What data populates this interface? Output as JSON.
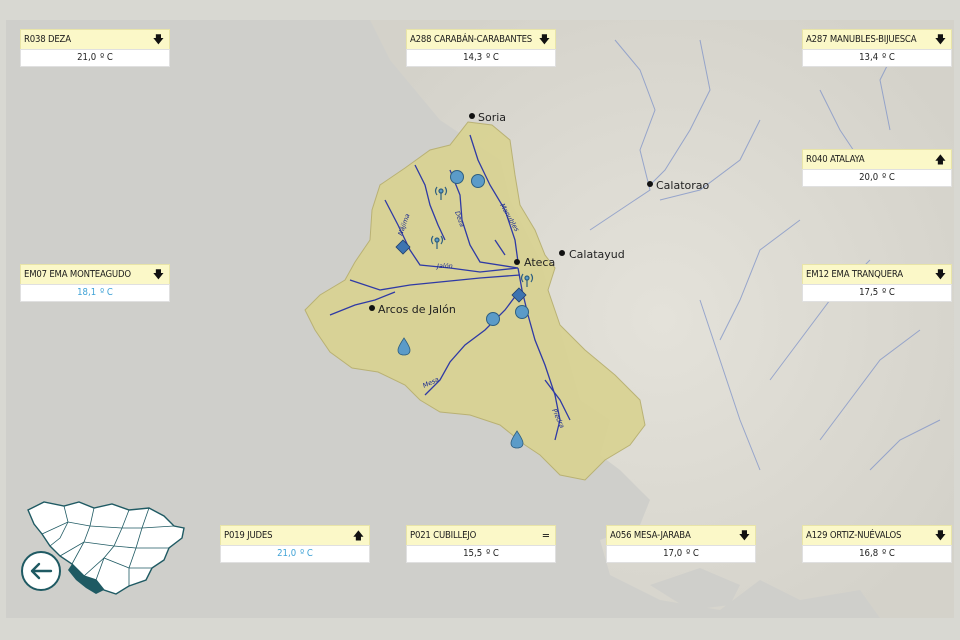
{
  "map": {
    "cities": [
      {
        "id": "soria",
        "label": "Soria"
      },
      {
        "id": "calatorao",
        "label": "Calatorao"
      },
      {
        "id": "calatayud",
        "label": "Calatayud"
      },
      {
        "id": "ateca",
        "label": "Ateca"
      },
      {
        "id": "arcos",
        "label": "Arcos de Jalón"
      }
    ],
    "rivers": [
      {
        "id": "jalon",
        "label": "Jalón"
      },
      {
        "id": "manubles",
        "label": "Manubles"
      },
      {
        "id": "deza",
        "label": "Deza"
      },
      {
        "id": "mesa",
        "label": "Mesa"
      },
      {
        "id": "piedra",
        "label": "Piedra"
      },
      {
        "id": "najima",
        "label": "Nájima"
      }
    ],
    "colors": {
      "basin": "#d9d394",
      "sea": "#cfcfcb",
      "river": "#2f3aa5",
      "marker": "#5b9bc8",
      "panel_header": "#fbf8c8",
      "accent": "#1f5a63"
    }
  },
  "stations": {
    "r038": {
      "code": "R038 DEZA",
      "value": "21,0",
      "unit": "º C",
      "trend": "🡇",
      "trend_name": "down-arrow-icon"
    },
    "a288": {
      "code": "A288 CARABÁN-CARABANTES",
      "value": "14,3",
      "unit": "º C",
      "trend": "🡇",
      "trend_name": "down-arrow-icon"
    },
    "a287": {
      "code": "A287 MANUBLES-BIJUESCA",
      "value": "13,4",
      "unit": "º C",
      "trend": "🡇",
      "trend_name": "down-arrow-icon"
    },
    "r040": {
      "code": "R040 ATALAYA",
      "value": "20,0",
      "unit": "º C",
      "trend": "🡅",
      "trend_name": "up-arrow-icon"
    },
    "em07": {
      "code": "EM07 EMA MONTEAGUDO",
      "value": "18,1",
      "unit": "º C",
      "trend": "🡇",
      "trend_name": "down-arrow-icon"
    },
    "em12": {
      "code": "EM12 EMA TRANQUERA",
      "value": "17,5",
      "unit": "º C",
      "trend": "🡇",
      "trend_name": "down-arrow-icon"
    },
    "p019": {
      "code": "P019 JUDES",
      "value": "21,0",
      "unit": "º C",
      "trend": "🡅",
      "trend_name": "up-arrow-icon"
    },
    "p021": {
      "code": "P021 CUBILLEJO",
      "value": "15,5",
      "unit": "º C",
      "trend": "=",
      "trend_name": "equal-icon"
    },
    "a056": {
      "code": "A056 MESA-JARABA",
      "value": "17,0",
      "unit": "º C",
      "trend": "🡇",
      "trend_name": "down-arrow-icon"
    },
    "a129": {
      "code": "A129 ORTIZ-NUÉVALOS",
      "value": "16,8",
      "unit": "º C",
      "trend": "🡇",
      "trend_name": "down-arrow-icon"
    }
  },
  "nav": {
    "back_icon": "left-arrow-icon"
  }
}
